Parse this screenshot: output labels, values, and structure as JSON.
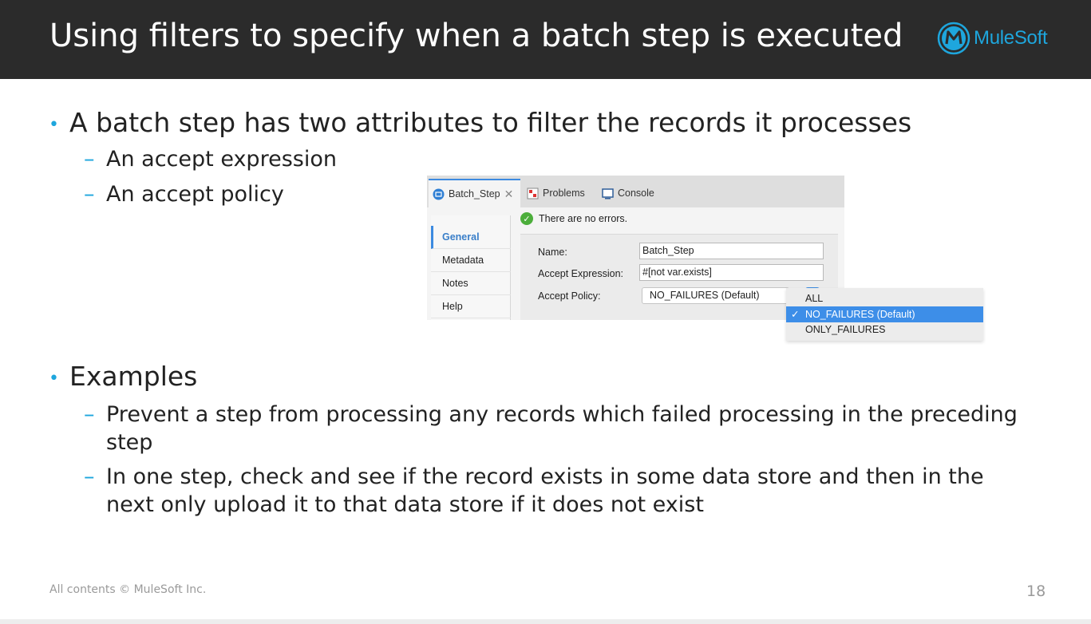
{
  "slide": {
    "title": "Using filters to specify when a batch step is executed",
    "logo_text": "MuleSoft",
    "bullets": [
      {
        "text": "A batch step has two attributes to filter the records it processes",
        "subs": [
          "An accept expression",
          "An accept policy"
        ]
      },
      {
        "text": "Examples",
        "subs": [
          "Prevent a step from processing any records which failed processing in the preceding step",
          "In one step, check and see if the record exists in some data store and then in the next only upload it to that data store if it does not exist"
        ]
      }
    ],
    "footer": "All contents © MuleSoft Inc.",
    "page_number": "18"
  },
  "ui": {
    "tabs": [
      {
        "label": "Batch_Step",
        "icon": "batch-step-icon",
        "active": true
      },
      {
        "label": "Problems",
        "icon": "problems-icon"
      },
      {
        "label": "Console",
        "icon": "console-icon"
      }
    ],
    "status": "There are no errors.",
    "nav": [
      "General",
      "Metadata",
      "Notes",
      "Help"
    ],
    "form": {
      "name_label": "Name:",
      "name_value": "Batch_Step",
      "expr_label": "Accept Expression:",
      "expr_value": "#[not var.exists]",
      "policy_label": "Accept Policy:",
      "policy_value": "NO_FAILURES (Default)"
    },
    "dropdown": {
      "options": [
        "ALL",
        "NO_FAILURES (Default)",
        "ONLY_FAILURES"
      ],
      "selected": "NO_FAILURES (Default)",
      "check": "✓"
    }
  },
  "colors": {
    "header_bg": "#2b2b2b",
    "accent": "#1ea6dd",
    "selection": "#3d8ee8"
  }
}
